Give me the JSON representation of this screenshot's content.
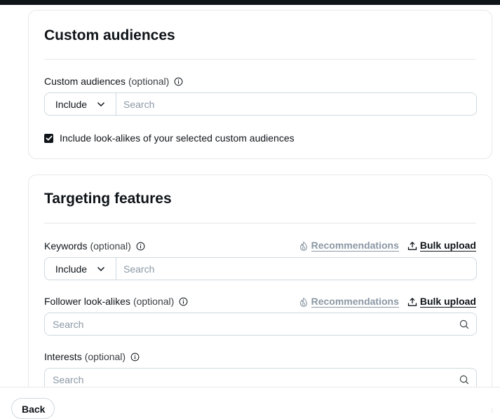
{
  "custom_audiences_card": {
    "title": "Custom audiences",
    "field": {
      "label": "Custom audiences",
      "optional": "(optional)",
      "mode": "Include",
      "placeholder": "Search"
    },
    "lookalike_checkbox": {
      "label": "Include look-alikes of your selected custom audiences",
      "checked": true
    }
  },
  "targeting_card": {
    "title": "Targeting features",
    "keywords": {
      "label": "Keywords",
      "optional": "(optional)",
      "mode": "Include",
      "placeholder": "Search",
      "recommendations": "Recommendations",
      "bulk_upload": "Bulk upload"
    },
    "follower_lookalikes": {
      "label": "Follower look-alikes",
      "optional": "(optional)",
      "placeholder": "Search",
      "recommendations": "Recommendations",
      "bulk_upload": "Bulk upload"
    },
    "interests": {
      "label": "Interests",
      "optional": "(optional)",
      "placeholder": "Search"
    }
  },
  "footer": {
    "back_label": "Back"
  },
  "colors": {
    "text": "#0f1419",
    "muted": "#8b98a5",
    "border": "#cfd9de",
    "divider": "#e6e8ea"
  },
  "icons": [
    "info-icon",
    "chevron-down-icon",
    "checkmark-icon",
    "flame-icon",
    "upload-icon",
    "search-icon"
  ]
}
